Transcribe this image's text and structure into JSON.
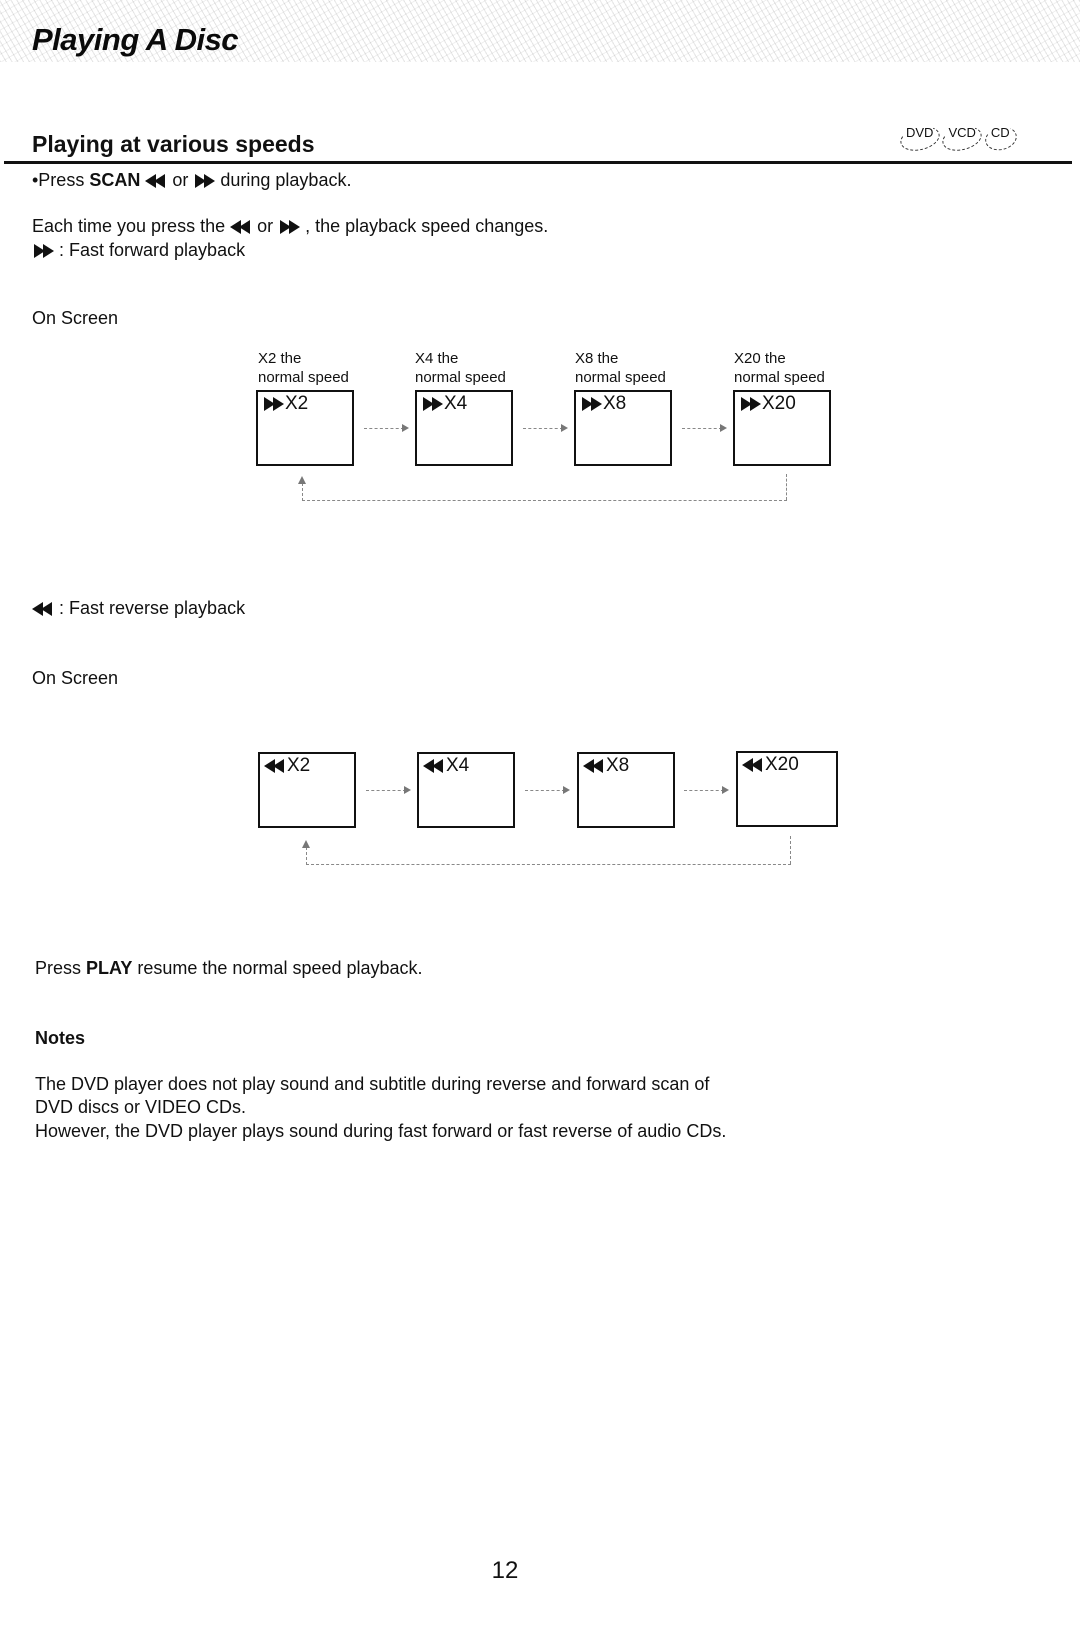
{
  "header": {
    "title": "Playing A Disc"
  },
  "section": {
    "title": "Playing at various speeds",
    "disc_types": [
      "DVD",
      "VCD",
      "CD"
    ]
  },
  "instructions": {
    "press_prefix": "•Press ",
    "press_key": "SCAN",
    "press_or": " or ",
    "press_suffix": " during playback.",
    "each_prefix": "Each time you press the ",
    "each_or": " or ",
    "each_suffix": " , the playback speed changes.",
    "ff_desc": " : Fast forward playback",
    "rw_desc": " : Fast reverse playback"
  },
  "icons": {
    "fast_forward": "fast-forward-icon",
    "fast_reverse": "fast-reverse-icon"
  },
  "on_screen_label": "On Screen",
  "forward_sequence": [
    {
      "caption_line1": "X2 the",
      "caption_line2": "normal speed",
      "osd": "X2"
    },
    {
      "caption_line1": "X4 the",
      "caption_line2": "normal speed",
      "osd": "X4"
    },
    {
      "caption_line1": "X8 the",
      "caption_line2": "normal speed",
      "osd": "X8"
    },
    {
      "caption_line1": "X20 the",
      "caption_line2": "normal speed",
      "osd": "X20"
    }
  ],
  "reverse_sequence": [
    {
      "osd": "X2"
    },
    {
      "osd": "X4"
    },
    {
      "osd": "X8"
    },
    {
      "osd": "X20"
    }
  ],
  "resume": {
    "prefix": "Press ",
    "key": "PLAY",
    "suffix": " resume the normal speed playback."
  },
  "notes": {
    "title": "Notes",
    "lines": [
      "The DVD player does not play sound and subtitle during reverse and forward scan of",
      "DVD discs or VIDEO CDs.",
      "However, the DVD player plays sound during fast forward or fast reverse of audio CDs."
    ]
  },
  "page_number": "12"
}
